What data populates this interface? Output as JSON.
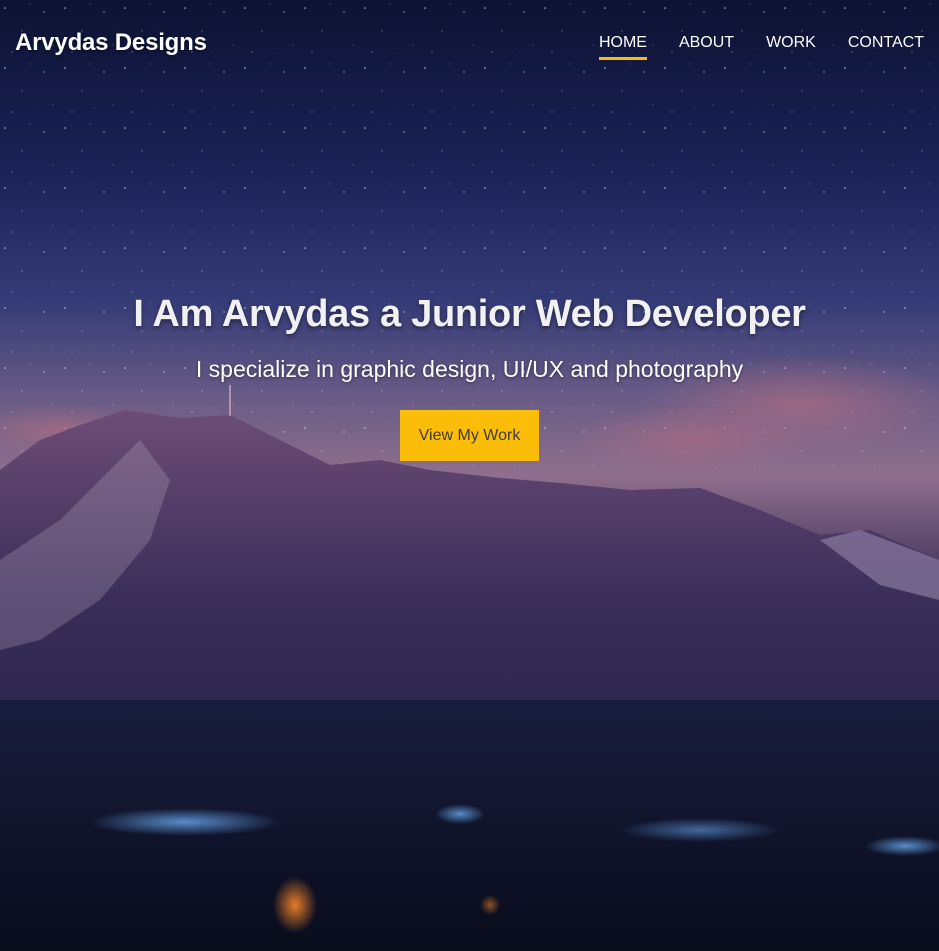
{
  "brand": {
    "name": "Arvydas Designs"
  },
  "nav": {
    "items": [
      {
        "label": "HOME",
        "active": true
      },
      {
        "label": "ABOUT",
        "active": false
      },
      {
        "label": "WORK",
        "active": false
      },
      {
        "label": "CONTACT",
        "active": false
      }
    ]
  },
  "hero": {
    "headline": "I Am Arvydas a Junior Web Developer",
    "subheadline": "I specialize in graphic design, UI/UX and photography",
    "cta_label": "View My Work"
  },
  "colors": {
    "accent": "#fbbd08",
    "sky_top": "#0d1333",
    "sky_mid": "#3a3f78",
    "horizon": "#a06a8a",
    "mountain": "#2a2347"
  }
}
